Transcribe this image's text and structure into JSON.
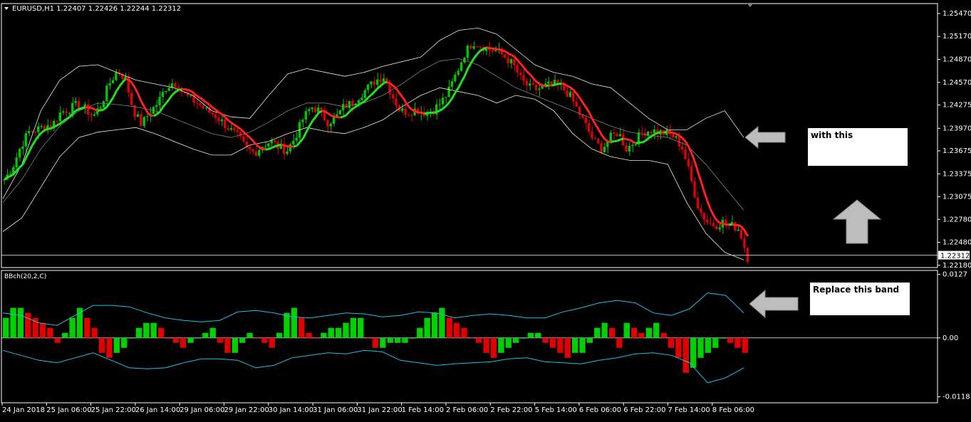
{
  "window": {
    "symbol_line": "EURUSD,H1  1.22407  1.22426  1.22244  1.22312"
  },
  "colors": {
    "background": "#000000",
    "grid_border": "#ffffff",
    "candle_bull": "#00c800",
    "candle_bear": "#e00000",
    "ma_up": "#22e022",
    "ma_down": "#ff2020",
    "band_price": "#ffffff",
    "band_mid": "#808080",
    "band_indicator": "#20c0e0",
    "indicator_bar_bull": "#00d000",
    "indicator_bar_bear": "#e00000"
  },
  "annotations": {
    "with_this": "with this",
    "replace_this_band": "Replace this band"
  },
  "icons": [
    "left-arrow-icon",
    "up-arrow-icon",
    "left-arrow-icon",
    "dropdown-triangle-icon"
  ],
  "chart_data": [
    {
      "type": "line",
      "panel": "price",
      "description": "EURUSD H1 candlestick chart with moving average and bands",
      "price_last_label": "1.22312",
      "price_last": 1.22312,
      "ylim": [
        1.2215,
        1.256
      ],
      "yticks": [
        "1.25470",
        "1.25170",
        "1.24870",
        "1.24570",
        "1.24275",
        "1.23970",
        "1.23675",
        "1.23375",
        "1.23075",
        "1.22780",
        "1.22480",
        "1.22180"
      ],
      "xticks": [
        "24 Jan 2018",
        "25 Jan 06:00",
        "25 Jan 22:00",
        "26 Jan 14:00",
        "29 Jan 06:00",
        "29 Jan 22:00",
        "30 Jan 14:00",
        "31 Jan 06:00",
        "31 Jan 22:00",
        "1 Feb 14:00",
        "2 Feb 06:00",
        "2 Feb 22:00",
        "5 Feb 14:00",
        "6 Feb 06:00",
        "6 Feb 22:00",
        "7 Feb 14:00",
        "8 Feb 06:00"
      ],
      "close_path": [
        1.233,
        1.2345,
        1.2372,
        1.2392,
        1.2395,
        1.24,
        1.2402,
        1.2418,
        1.2422,
        1.2428,
        1.2423,
        1.2412,
        1.2428,
        1.2455,
        1.2472,
        1.2462,
        1.242,
        1.2402,
        1.2418,
        1.243,
        1.245,
        1.2458,
        1.2445,
        1.2435,
        1.243,
        1.242,
        1.2415,
        1.2405,
        1.2395,
        1.2385,
        1.237,
        1.2365,
        1.2375,
        1.238,
        1.2372,
        1.2368,
        1.2385,
        1.241,
        1.2425,
        1.242,
        1.2405,
        1.241,
        1.2425,
        1.243,
        1.244,
        1.245,
        1.246,
        1.2465,
        1.244,
        1.242,
        1.2418,
        1.2422,
        1.2418,
        1.242,
        1.243,
        1.2445,
        1.247,
        1.2495,
        1.251,
        1.2505,
        1.25,
        1.2498,
        1.249,
        1.248,
        1.246,
        1.245,
        1.2448,
        1.2452,
        1.2455,
        1.245,
        1.244,
        1.242,
        1.24,
        1.238,
        1.237,
        1.2385,
        1.2392,
        1.237,
        1.238,
        1.2392,
        1.2395,
        1.2392,
        1.239,
        1.2385,
        1.237,
        1.233,
        1.229,
        1.2275,
        1.227,
        1.2275,
        1.227,
        1.2265,
        1.2228
      ],
      "bands": {
        "upper_path": [
          1.2305,
          1.235,
          1.242,
          1.246,
          1.2478,
          1.248,
          1.247,
          1.246,
          1.2455,
          1.245,
          1.244,
          1.242,
          1.2412,
          1.241,
          1.244,
          1.2468,
          1.2475,
          1.247,
          1.2465,
          1.247,
          1.2478,
          1.2484,
          1.249,
          1.2512,
          1.2525,
          1.2528,
          1.252,
          1.25,
          1.248,
          1.247,
          1.2465,
          1.2455,
          1.245,
          1.243,
          1.241,
          1.2395,
          1.2395,
          1.241,
          1.242,
          1.2385
        ],
        "mid_path": [
          1.23,
          1.233,
          1.237,
          1.24,
          1.242,
          1.243,
          1.2428,
          1.2425,
          1.242,
          1.241,
          1.24,
          1.239,
          1.2385,
          1.2392,
          1.2405,
          1.242,
          1.243,
          1.243,
          1.2425,
          1.243,
          1.244,
          1.2455,
          1.2472,
          1.2485,
          1.2488,
          1.248,
          1.2465,
          1.245,
          1.244,
          1.243,
          1.242,
          1.241,
          1.24,
          1.2392,
          1.2388,
          1.2385,
          1.2375,
          1.235,
          1.232,
          1.229
        ],
        "lower_path": [
          1.2262,
          1.228,
          1.232,
          1.236,
          1.2385,
          1.2392,
          1.2395,
          1.2398,
          1.239,
          1.238,
          1.237,
          1.2362,
          1.2362,
          1.2375,
          1.238,
          1.239,
          1.2398,
          1.2393,
          1.239,
          1.2398,
          1.2408,
          1.2425,
          1.244,
          1.245,
          1.2445,
          1.244,
          1.243,
          1.244,
          1.2435,
          1.242,
          1.239,
          1.237,
          1.236,
          1.2355,
          1.2355,
          1.235,
          1.23,
          1.226,
          1.2235,
          1.2225
        ]
      }
    },
    {
      "type": "bar",
      "panel": "indicator",
      "title": "BBch(20,2,C)",
      "ylim": [
        -0.013,
        0.0135
      ],
      "yticks": [
        "0.0127",
        "0.00",
        "-0.0118"
      ],
      "zero_label": "0.00",
      "values": [
        0.004,
        0.006,
        0.006,
        0.005,
        0.004,
        0.003,
        0.002,
        -0.001,
        0.001,
        0.004,
        0.006,
        0.004,
        0.002,
        -0.003,
        -0.004,
        -0.003,
        -0.002,
        0.0,
        0.002,
        0.003,
        0.003,
        0.002,
        0.0,
        -0.001,
        -0.002,
        -0.001,
        0.0,
        0.001,
        0.002,
        -0.001,
        -0.003,
        -0.003,
        -0.001,
        0.001,
        0.0,
        -0.001,
        -0.002,
        0.001,
        0.005,
        0.006,
        0.004,
        0.001,
        0.0,
        0.001,
        0.002,
        0.002,
        0.003,
        0.004,
        0.004,
        0.0,
        -0.002,
        -0.002,
        -0.001,
        -0.001,
        -0.001,
        0.0,
        0.002,
        0.004,
        0.005,
        0.006,
        0.004,
        0.003,
        0.002,
        0.0,
        -0.001,
        -0.003,
        -0.004,
        -0.003,
        -0.002,
        -0.001,
        0.0,
        0.001,
        0.001,
        -0.001,
        -0.002,
        -0.003,
        -0.004,
        -0.003,
        -0.003,
        -0.001,
        0.002,
        0.003,
        0.002,
        -0.002,
        0.003,
        0.002,
        0.001,
        0.002,
        0.003,
        0.001,
        -0.002,
        -0.004,
        -0.007,
        -0.006,
        -0.004,
        -0.003,
        -0.002,
        0.0,
        -0.001,
        -0.002,
        -0.003
      ],
      "bands": {
        "upper_path": [
          0.005,
          0.0045,
          0.003,
          0.0025,
          0.0045,
          0.0065,
          0.0065,
          0.0062,
          0.005,
          0.004,
          0.0035,
          0.0032,
          0.0035,
          0.0052,
          0.0055,
          0.005,
          0.0042,
          0.004,
          0.0045,
          0.005,
          0.0048,
          0.0042,
          0.0045,
          0.0052,
          0.005,
          0.004,
          0.0045,
          0.0048,
          0.0045,
          0.004,
          0.004,
          0.0052,
          0.006,
          0.007,
          0.0075,
          0.007,
          0.005,
          0.0045,
          0.0058,
          0.009,
          0.0085,
          0.005
        ],
        "lower_path": [
          -0.0025,
          -0.0035,
          -0.0045,
          -0.005,
          -0.004,
          -0.003,
          -0.0045,
          -0.006,
          -0.0062,
          -0.006,
          -0.005,
          -0.0042,
          -0.0042,
          -0.0045,
          -0.006,
          -0.0055,
          -0.004,
          -0.0035,
          -0.003,
          -0.0032,
          -0.0025,
          -0.0028,
          -0.0045,
          -0.005,
          -0.0055,
          -0.0052,
          -0.005,
          -0.0048,
          -0.0042,
          -0.004,
          -0.0048,
          -0.005,
          -0.0052,
          -0.0045,
          -0.004,
          -0.0032,
          -0.003,
          -0.0035,
          -0.005,
          -0.009,
          -0.008,
          -0.006
        ]
      }
    }
  ]
}
